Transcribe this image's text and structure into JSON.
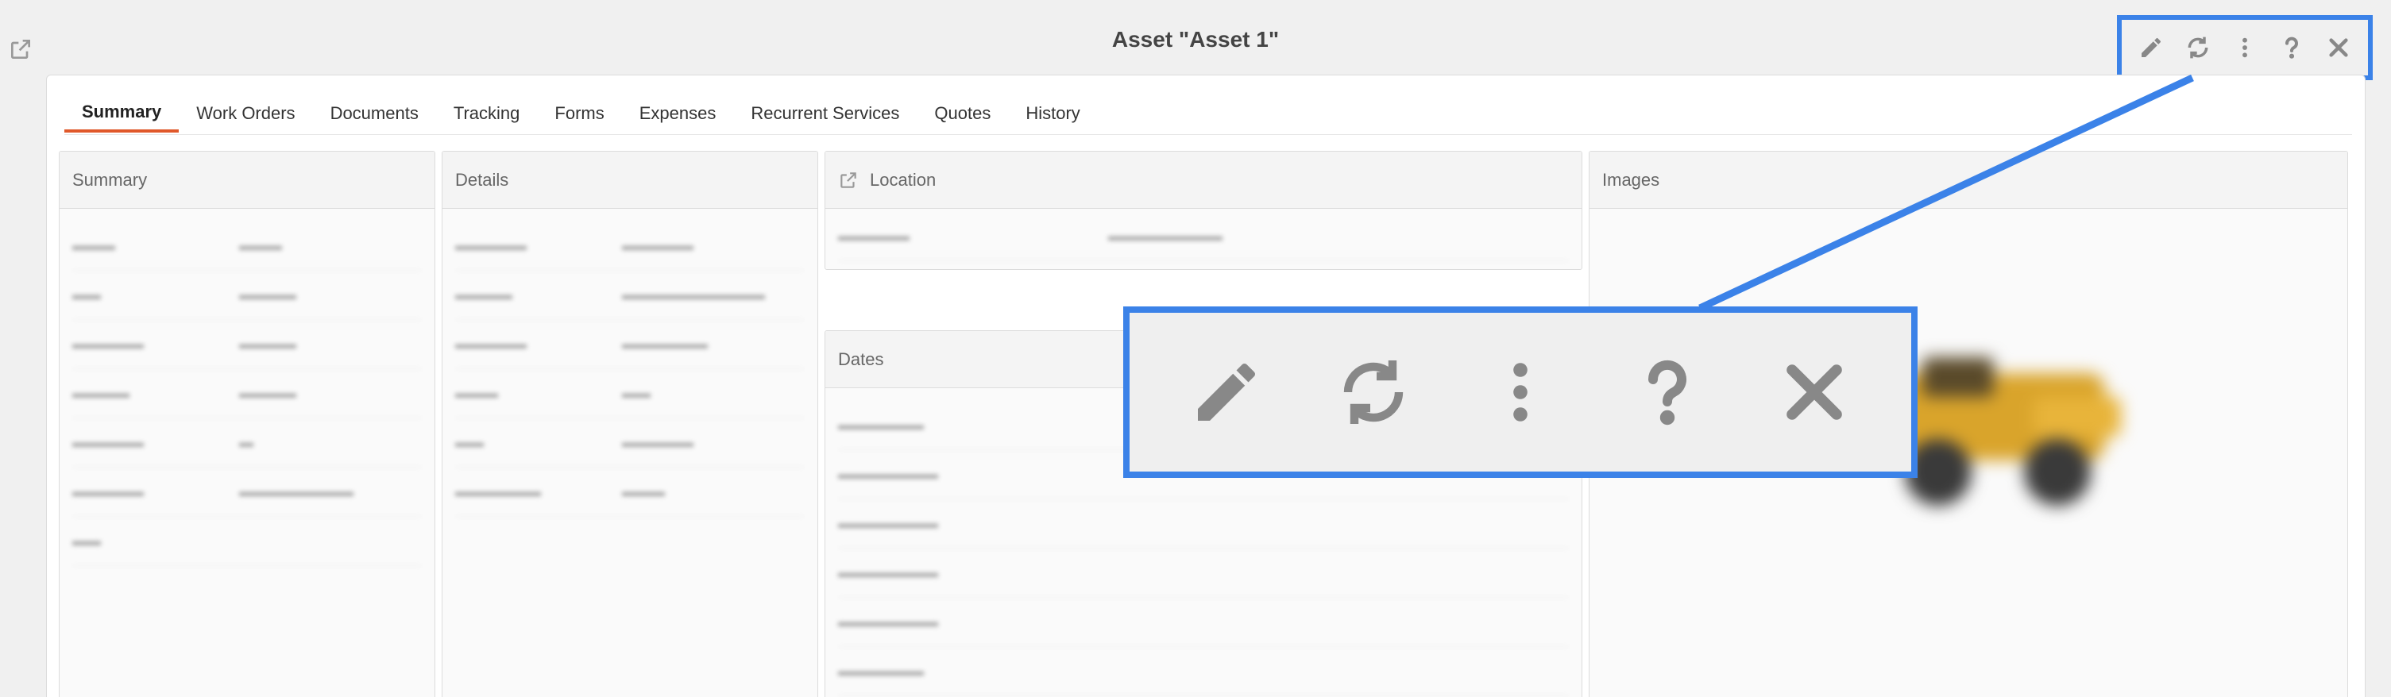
{
  "header": {
    "title": "Asset \"Asset 1\""
  },
  "toolbar": {
    "actions": [
      {
        "name": "edit",
        "icon": "pencil-icon"
      },
      {
        "name": "refresh",
        "icon": "refresh-icon"
      },
      {
        "name": "more",
        "icon": "more-vertical-icon"
      },
      {
        "name": "help",
        "icon": "question-icon"
      },
      {
        "name": "close",
        "icon": "close-icon"
      }
    ]
  },
  "tabs": [
    {
      "label": "Summary",
      "active": true
    },
    {
      "label": "Work Orders"
    },
    {
      "label": "Documents"
    },
    {
      "label": "Tracking"
    },
    {
      "label": "Forms"
    },
    {
      "label": "Expenses"
    },
    {
      "label": "Recurrent Services"
    },
    {
      "label": "Quotes"
    },
    {
      "label": "History"
    }
  ],
  "panels": {
    "summary": {
      "title": "Summary"
    },
    "details": {
      "title": "Details"
    },
    "location": {
      "title": "Location"
    },
    "dates": {
      "title": "Dates"
    },
    "images": {
      "title": "Images"
    }
  },
  "colors": {
    "accent_tab": "#e0582a",
    "highlight": "#3b82e8",
    "icon_gray": "#888888"
  }
}
